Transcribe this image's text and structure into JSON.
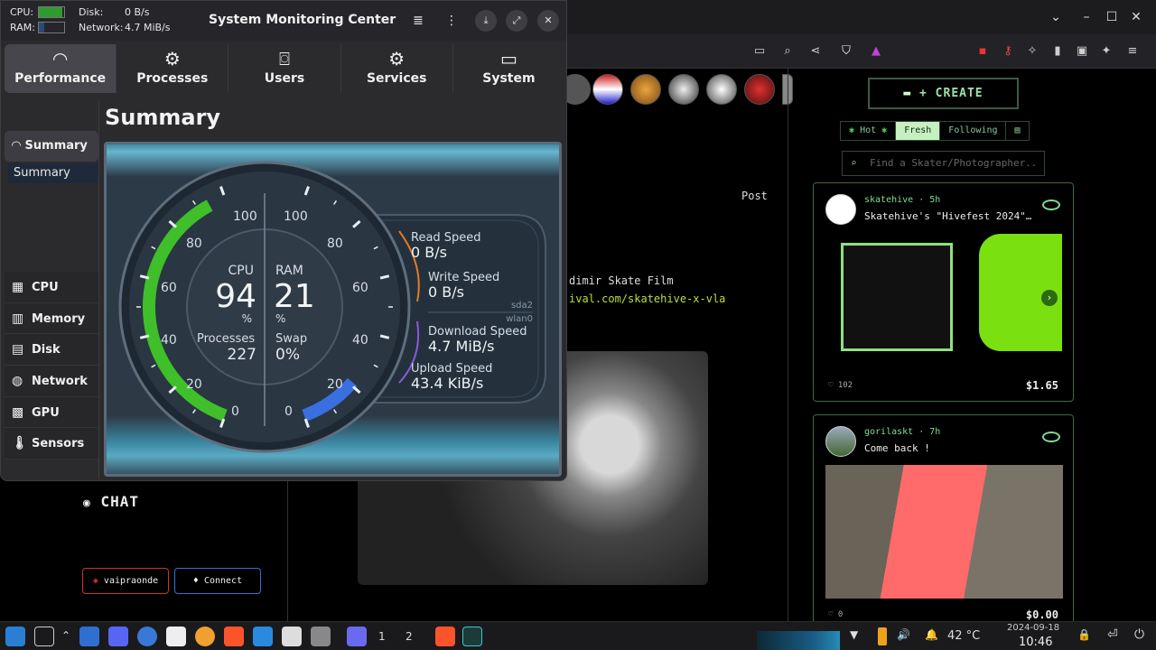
{
  "monitor": {
    "mini": {
      "cpu_label": "CPU:",
      "ram_label": "RAM:",
      "disk_label": "Disk:",
      "disk_value": "0 B/s",
      "network_label": "Network:",
      "network_value": "4.7 MiB/s",
      "cpu_fraction": 0.94,
      "ram_fraction": 0.21
    },
    "title": "System Monitoring Center",
    "tabs": [
      {
        "label": "Performance",
        "icon": "speedometer-icon"
      },
      {
        "label": "Processes",
        "icon": "gear-icon"
      },
      {
        "label": "Users",
        "icon": "mouse-icon"
      },
      {
        "label": "Services",
        "icon": "gears-icon"
      },
      {
        "label": "System",
        "icon": "monitor-icon"
      }
    ],
    "sidebar": {
      "section": "Summary",
      "sub": "Summary",
      "items": [
        "CPU",
        "Memory",
        "Disk",
        "Network",
        "GPU",
        "Sensors"
      ]
    },
    "summary_title": "Summary",
    "gauge": {
      "cpu_label": "CPU",
      "cpu_value": "94",
      "cpu_unit": "%",
      "ram_label": "RAM",
      "ram_value": "21",
      "ram_unit": "%",
      "processes_label": "Processes",
      "processes_value": "227",
      "swap_label": "Swap",
      "swap_value": "0%",
      "cpu_percent": 94,
      "ram_percent": 21,
      "ticks_left": [
        "100",
        "80",
        "60",
        "40",
        "20",
        "0"
      ],
      "ticks_right": [
        "100",
        "80",
        "60",
        "40",
        "20",
        "0"
      ],
      "read_label": "Read Speed",
      "read_value": "0 B/s",
      "write_label": "Write Speed",
      "write_value": "0 B/s",
      "disk_name": "sda2",
      "net_name": "wlan0",
      "download_label": "Download Speed",
      "download_value": "4.7 MiB/s",
      "upload_label": "Upload Speed",
      "upload_value": "43.4 KiB/s"
    }
  },
  "browser": {
    "post_label": "Post",
    "film_text": "dimir Skate Film",
    "film_link": "ival.com/skatehive-x-vla",
    "chat_label": "CHAT",
    "user_button": "vaipraonde",
    "connect_button": "Connect",
    "create_button": "+ CREATE",
    "feed_tabs": [
      "Hot",
      "Fresh",
      "Following"
    ],
    "search_placeholder": "Find a Skater/Photographer..",
    "cards": [
      {
        "author": "skatehive · 5h",
        "title": "Skatehive's \"Hivefest 2024\"…",
        "likes": "102",
        "price": "$1.65"
      },
      {
        "author": "gorilaskt · 7h",
        "title": "Come back !",
        "likes": "0",
        "price": "$0.00"
      }
    ]
  },
  "taskbar": {
    "workspace_1": "1",
    "workspace_2": "2",
    "temperature": "42 °C",
    "date": "2024-09-18",
    "time": "10:46"
  }
}
